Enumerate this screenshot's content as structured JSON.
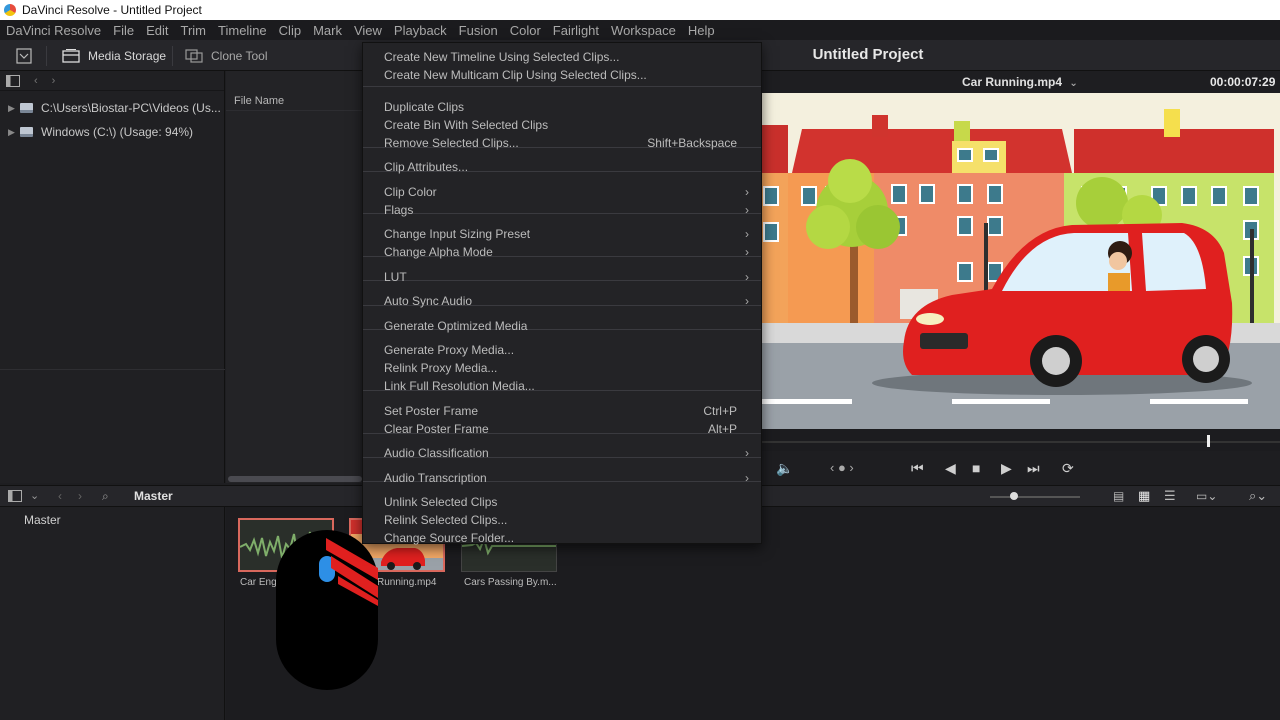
{
  "window": {
    "title": "DaVinci Resolve - Untitled Project"
  },
  "menubar": [
    "DaVinci Resolve",
    "File",
    "Edit",
    "Trim",
    "Timeline",
    "Clip",
    "Mark",
    "View",
    "Playback",
    "Fusion",
    "Color",
    "Fairlight",
    "Workspace",
    "Help"
  ],
  "toolbar": {
    "media_storage": "Media Storage",
    "clone_tool": "Clone Tool",
    "project_title": "Untitled Project"
  },
  "storage": {
    "items": [
      {
        "label": "C:\\Users\\Biostar-PC\\Videos (Us..."
      },
      {
        "label": "Windows (C:\\) (Usage: 94%)"
      }
    ],
    "file_name_header": "File Name"
  },
  "viewer": {
    "clip_name": "Car Running.mp4",
    "timecode": "00:00:07:29",
    "playhead_fraction": 0.86
  },
  "media_pool": {
    "bin_title": "Master",
    "bins": [
      "Master"
    ],
    "clips": [
      {
        "label": "Car Eng"
      },
      {
        "label": "Running.mp4"
      },
      {
        "label": "Cars Passing By.m..."
      }
    ]
  },
  "context_menu": {
    "items": [
      {
        "label": "Create New Timeline Using Selected Clips...",
        "shortcut": "",
        "submenu": false
      },
      {
        "label": "Create New Multicam Clip Using Selected Clips...",
        "shortcut": "",
        "submenu": false
      },
      {
        "label": "Duplicate Clips",
        "shortcut": "",
        "submenu": false
      },
      {
        "label": "Create Bin With Selected Clips",
        "shortcut": "",
        "submenu": false
      },
      {
        "label": "Remove Selected Clips...",
        "shortcut": "Shift+Backspace",
        "submenu": false
      },
      {
        "label": "Clip Attributes...",
        "shortcut": "",
        "submenu": false
      },
      {
        "label": "Clip Color",
        "shortcut": "",
        "submenu": true
      },
      {
        "label": "Flags",
        "shortcut": "",
        "submenu": true
      },
      {
        "label": "Change Input Sizing Preset",
        "shortcut": "",
        "submenu": true
      },
      {
        "label": "Change Alpha Mode",
        "shortcut": "",
        "submenu": true
      },
      {
        "label": "LUT",
        "shortcut": "",
        "submenu": true
      },
      {
        "label": "Auto Sync Audio",
        "shortcut": "",
        "submenu": true
      },
      {
        "label": "Generate Optimized Media",
        "shortcut": "",
        "submenu": false
      },
      {
        "label": "Generate Proxy Media...",
        "shortcut": "",
        "submenu": false
      },
      {
        "label": "Relink Proxy Media...",
        "shortcut": "",
        "submenu": false
      },
      {
        "label": "Link Full Resolution Media...",
        "shortcut": "",
        "submenu": false
      },
      {
        "label": "Set Poster Frame",
        "shortcut": "Ctrl+P",
        "submenu": false
      },
      {
        "label": "Clear Poster Frame",
        "shortcut": "Alt+P",
        "submenu": false
      },
      {
        "label": "Audio Classification",
        "shortcut": "",
        "submenu": true
      },
      {
        "label": "Audio Transcription",
        "shortcut": "",
        "submenu": true
      },
      {
        "label": "Unlink Selected Clips",
        "shortcut": "",
        "submenu": false
      },
      {
        "label": "Relink Selected Clips...",
        "shortcut": "",
        "submenu": false
      },
      {
        "label": "Change Source Folder...",
        "shortcut": "",
        "submenu": false
      }
    ]
  },
  "icons": {
    "submenu_arrow": "chevron-right-icon",
    "mouse_overlay": "mouse-icon"
  },
  "colors": {
    "selection": "#d9685d",
    "car_red": "#e0201f",
    "sky_blue": "#2f9bd8"
  }
}
